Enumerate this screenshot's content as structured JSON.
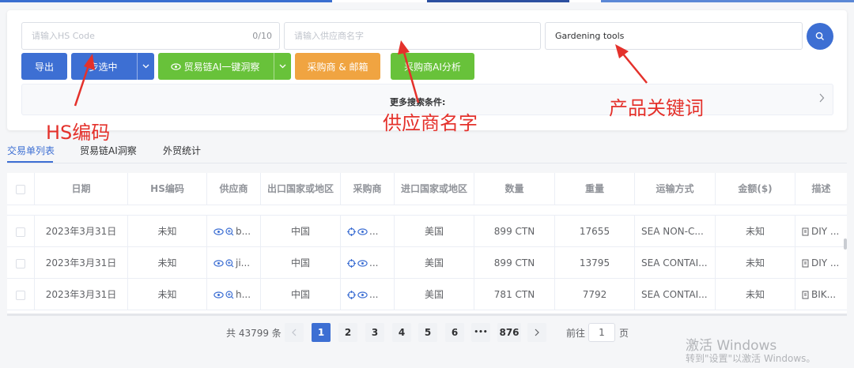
{
  "search": {
    "hs_code_placeholder": "请输入HS Code",
    "hs_code_count": "0/10",
    "supplier_placeholder": "请输入供应商名字",
    "keyword_value": "Gardening tools"
  },
  "toolbar": {
    "export_label": "导出",
    "sync_label": "步选中",
    "ai_insight_label": "贸易链AI一键洞察",
    "buyer_email_label": "采购商 & 邮箱",
    "buyer_ai_label": "采购商AI分析"
  },
  "more_conditions": {
    "label": "更多搜索条件:"
  },
  "annotations": {
    "hs_code": "HS编码",
    "supplier": "供应商名字",
    "keyword": "产品关键词"
  },
  "tabs": [
    {
      "label": "交易单列表"
    },
    {
      "label": "贸易链AI洞察"
    },
    {
      "label": "外贸统计"
    }
  ],
  "table": {
    "headers": [
      "日期",
      "HS编码",
      "供应商",
      "出口国家或地区",
      "采购商",
      "进口国家或地区",
      "数量",
      "重量",
      "运输方式",
      "金额($)",
      "描述"
    ],
    "rows": [
      {
        "date": "2023年3月31日",
        "hs": "未知",
        "supplier": "b...",
        "export_country": "中国",
        "buyer": "...",
        "import_country": "美国",
        "qty": "899 CTN",
        "weight": "17655",
        "transport": "SEA NON-C...",
        "amount": "未知",
        "desc": "DIY ..."
      },
      {
        "date": "2023年3月31日",
        "hs": "未知",
        "supplier": "ji...",
        "export_country": "中国",
        "buyer": "...",
        "import_country": "美国",
        "qty": "899 CTN",
        "weight": "13795",
        "transport": "SEA CONTAI...",
        "amount": "未知",
        "desc": "DIY ..."
      },
      {
        "date": "2023年3月31日",
        "hs": "未知",
        "supplier": "h...",
        "export_country": "中国",
        "buyer": "...",
        "import_country": "美国",
        "qty": "781 CTN",
        "weight": "7792",
        "transport": "SEA CONTAI...",
        "amount": "未知",
        "desc": "BIK..."
      }
    ]
  },
  "pagination": {
    "total_text": "共 43799 条",
    "pages": [
      "1",
      "2",
      "3",
      "4",
      "5",
      "6"
    ],
    "ellipsis": "•••",
    "last_page": "876",
    "goto_label": "前往",
    "goto_value": "1",
    "page_suffix": "页"
  },
  "watermark": {
    "line1": "激活 Windows",
    "line2": "转到\"设置\"以激活 Windows。"
  },
  "colors": {
    "primary": "#3d6fd3",
    "green": "#68c23a",
    "orange": "#f0a441",
    "annotation": "#e4312b"
  }
}
